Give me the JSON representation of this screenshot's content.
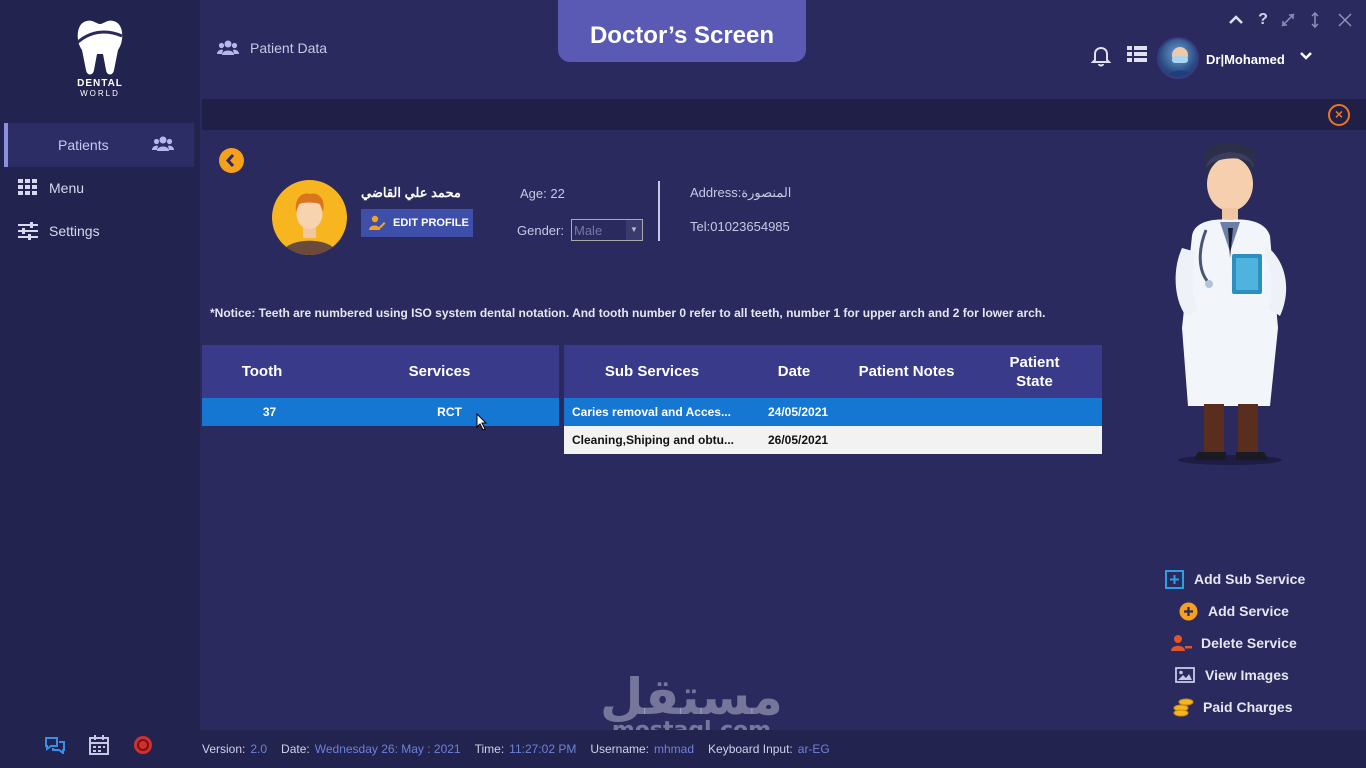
{
  "app": {
    "brand_line1": "DENTAL",
    "brand_line2": "WORLD",
    "screen_badge": "Doctor’s Screen",
    "page_title": "Patient Data"
  },
  "sidebar": {
    "items": [
      {
        "label": "Patients",
        "icon": "users-icon",
        "active": true
      },
      {
        "label": "Menu",
        "icon": "grid-icon",
        "active": false
      },
      {
        "label": "Settings",
        "icon": "sliders-icon",
        "active": false
      }
    ],
    "bottom_icons": [
      "chat-icon",
      "calendar-icon",
      "power-icon"
    ]
  },
  "header": {
    "user_name": "Dr|Mohamed",
    "icons": [
      "bell-icon",
      "list-icon"
    ],
    "window_controls": [
      "chevron-up-icon",
      "help-icon",
      "minimize-icon",
      "resize-icon",
      "close-icon"
    ]
  },
  "patient": {
    "name": "محمد علي القاضي",
    "edit_label": "EDIT PROFILE",
    "age_label": "Age:",
    "age": "22",
    "gender_label": "Gender:",
    "gender": "Male",
    "address_label": "Address:",
    "address": "المنصورة",
    "tel_label": "Tel:",
    "tel": "01023654985"
  },
  "notice": "*Notice: Teeth are numbered using ISO system dental notation. And tooth number 0 refer to all teeth, number 1 for upper arch and 2 for lower arch.",
  "services_table": {
    "headers": [
      "Tooth",
      "Services"
    ],
    "rows": [
      {
        "tooth": "37",
        "service": "RCT"
      }
    ]
  },
  "sub_services_table": {
    "headers": [
      "Sub Services",
      "Date",
      "Patient Notes",
      "Patient State"
    ],
    "rows": [
      {
        "sub_service": "Caries removal and Acces...",
        "date": "24/05/2021",
        "notes": "",
        "state": ""
      },
      {
        "sub_service": "Cleaning,Shiping and obtu...",
        "date": "26/05/2021",
        "notes": "",
        "state": ""
      }
    ]
  },
  "actions": [
    {
      "label": "Add Sub Service",
      "icon": "plus-square-icon",
      "color": "#2ea0e0"
    },
    {
      "label": "Add Service",
      "icon": "plus-circle-icon",
      "color": "#f5a11d"
    },
    {
      "label": "Delete Service",
      "icon": "user-minus-icon",
      "color": "#e0552a"
    },
    {
      "label": "View Images",
      "icon": "image-icon",
      "color": "#c8c8e6"
    },
    {
      "label": "Paid Charges",
      "icon": "coins-icon",
      "color": "#f5b51f"
    }
  ],
  "status_bar": {
    "version_label": "Version:",
    "version": "2.0",
    "date_label": "Date:",
    "date": "Wednesday  26: May : 2021",
    "time_label": "Time:",
    "time": "11:27:02 PM",
    "username_label": "Username:",
    "username": "mhmad",
    "keyboard_label": "Keyboard Input:",
    "keyboard": "ar-EG"
  },
  "watermark": {
    "arabic": "مستقل",
    "latin": "mostaql.com"
  },
  "colors": {
    "background": "#2a2a5e",
    "sidebar": "#232350",
    "accent": "#5a5ab4",
    "table_header": "#3a3a8a",
    "selected_row": "#1677d2",
    "orange": "#f5a11d"
  }
}
